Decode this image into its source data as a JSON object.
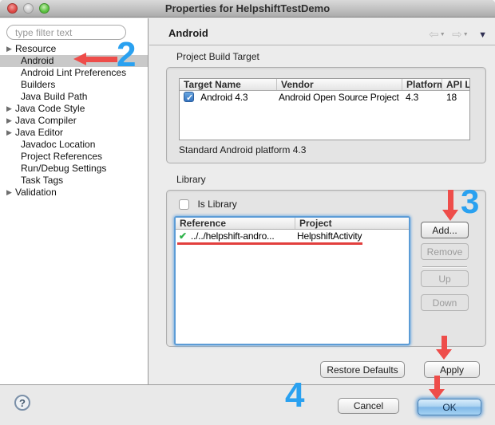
{
  "window": {
    "title": "Properties for HelpshiftTestDemo"
  },
  "sidebar": {
    "filter_placeholder": "type filter text",
    "items": [
      {
        "label": "Resource",
        "expandable": true,
        "selected": false
      },
      {
        "label": "Android",
        "expandable": false,
        "selected": true
      },
      {
        "label": "Android Lint Preferences",
        "expandable": false,
        "selected": false
      },
      {
        "label": "Builders",
        "expandable": false,
        "selected": false
      },
      {
        "label": "Java Build Path",
        "expandable": false,
        "selected": false
      },
      {
        "label": "Java Code Style",
        "expandable": true,
        "selected": false
      },
      {
        "label": "Java Compiler",
        "expandable": true,
        "selected": false
      },
      {
        "label": "Java Editor",
        "expandable": true,
        "selected": false
      },
      {
        "label": "Javadoc Location",
        "expandable": false,
        "selected": false
      },
      {
        "label": "Project References",
        "expandable": false,
        "selected": false
      },
      {
        "label": "Run/Debug Settings",
        "expandable": false,
        "selected": false
      },
      {
        "label": "Task Tags",
        "expandable": false,
        "selected": false
      },
      {
        "label": "Validation",
        "expandable": true,
        "selected": false
      }
    ]
  },
  "header": {
    "title": "Android"
  },
  "build_target": {
    "group_label": "Project Build Target",
    "columns": [
      "Target Name",
      "Vendor",
      "Platform",
      "API Le"
    ],
    "row": {
      "checked": true,
      "target_name": "Android 4.3",
      "vendor": "Android Open Source Project",
      "platform": "4.3",
      "api_level": "18"
    },
    "status": "Standard Android platform 4.3"
  },
  "library": {
    "group_label": "Library",
    "is_library_label": "Is Library",
    "is_library_checked": false,
    "columns": [
      "Reference",
      "Project"
    ],
    "row": {
      "reference": "../../helpshift-andro...",
      "project": "HelpshiftActivity"
    },
    "buttons": {
      "add": "Add...",
      "remove": "Remove",
      "up": "Up",
      "down": "Down"
    }
  },
  "actions": {
    "restore_defaults": "Restore Defaults",
    "apply": "Apply",
    "cancel": "Cancel",
    "ok": "OK",
    "help": "?"
  },
  "annotations": {
    "step2": "2",
    "step3": "3",
    "step4": "4"
  },
  "colors": {
    "annotation_red": "#ee4d4a",
    "annotation_blue": "#2aa1f0",
    "underline_red": "#e23f3d",
    "ok_button_blue": "#7fb7e7",
    "check_green": "#2fb34a",
    "selected_row_gray": "#c9c9c9"
  }
}
